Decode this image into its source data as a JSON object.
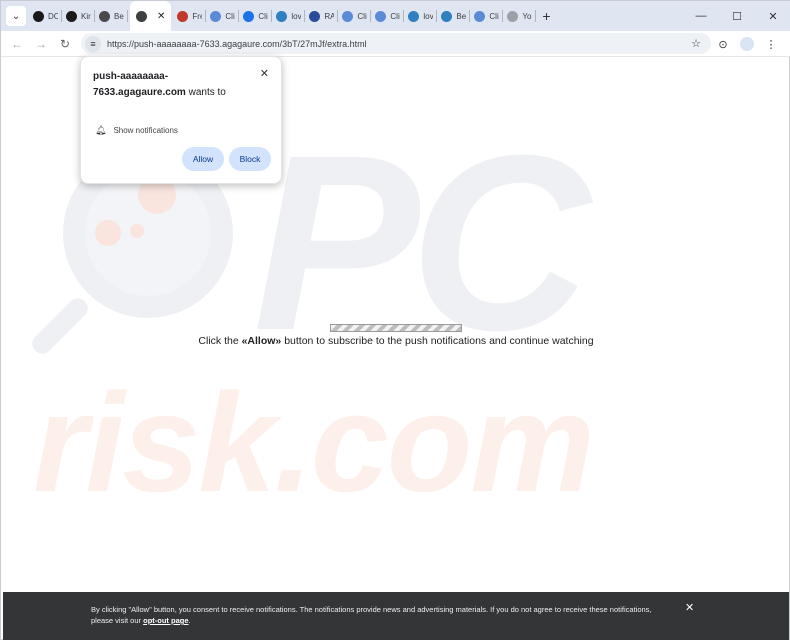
{
  "browser": {
    "tabs": [
      {
        "title": "DO",
        "favicon": "#1a1a1a"
      },
      {
        "title": "Kiri",
        "favicon": "#1a1a1a"
      },
      {
        "title": "Bel",
        "favicon": "#4a4a4a"
      },
      {
        "title": "",
        "favicon": "#3c4043",
        "active": true
      },
      {
        "title": "Fre",
        "favicon": "#c0392b"
      },
      {
        "title": "Clic",
        "favicon": "#5b8bd6"
      },
      {
        "title": "Clic",
        "favicon": "#1a73e8"
      },
      {
        "title": "lov",
        "favicon": "#2f7fc1"
      },
      {
        "title": "RAI",
        "favicon": "#2b4c9b"
      },
      {
        "title": "Clic",
        "favicon": "#5b8bd6"
      },
      {
        "title": "Clic",
        "favicon": "#5b8bd6"
      },
      {
        "title": "lov",
        "favicon": "#2f7fc1"
      },
      {
        "title": "Bes",
        "favicon": "#2f7fc1"
      },
      {
        "title": "Clic",
        "favicon": "#5b8bd6"
      },
      {
        "title": "You",
        "favicon": "#9aa0a6"
      }
    ],
    "new_tab": "+",
    "window_controls": {
      "minimize": "—",
      "maximize": "☐",
      "close": "✕"
    },
    "url": "https://push-aaaaaaaa-7633.agagaure.com/3bT/27mJf/extra.html"
  },
  "popup": {
    "host": "push-aaaaaaaa-7633.agagaure.com",
    "wants_to": "wants to",
    "permission": "Show notifications",
    "allow_label": "Allow",
    "block_label": "Block"
  },
  "page": {
    "message_prefix": "Click the ",
    "message_highlight": "«Allow»",
    "message_suffix": " button to subscribe to the push notifications and continue watching"
  },
  "bottom_bar": {
    "text": "By clicking \"Allow\" button, you consent to receive notifications. The notifications provide news and advertising materials. If you do not agree to receive these notifications, please visit our ",
    "link": "opt-out page",
    "text_end": "."
  },
  "watermark": {
    "top": "PC",
    "bottom": "risk.com"
  }
}
